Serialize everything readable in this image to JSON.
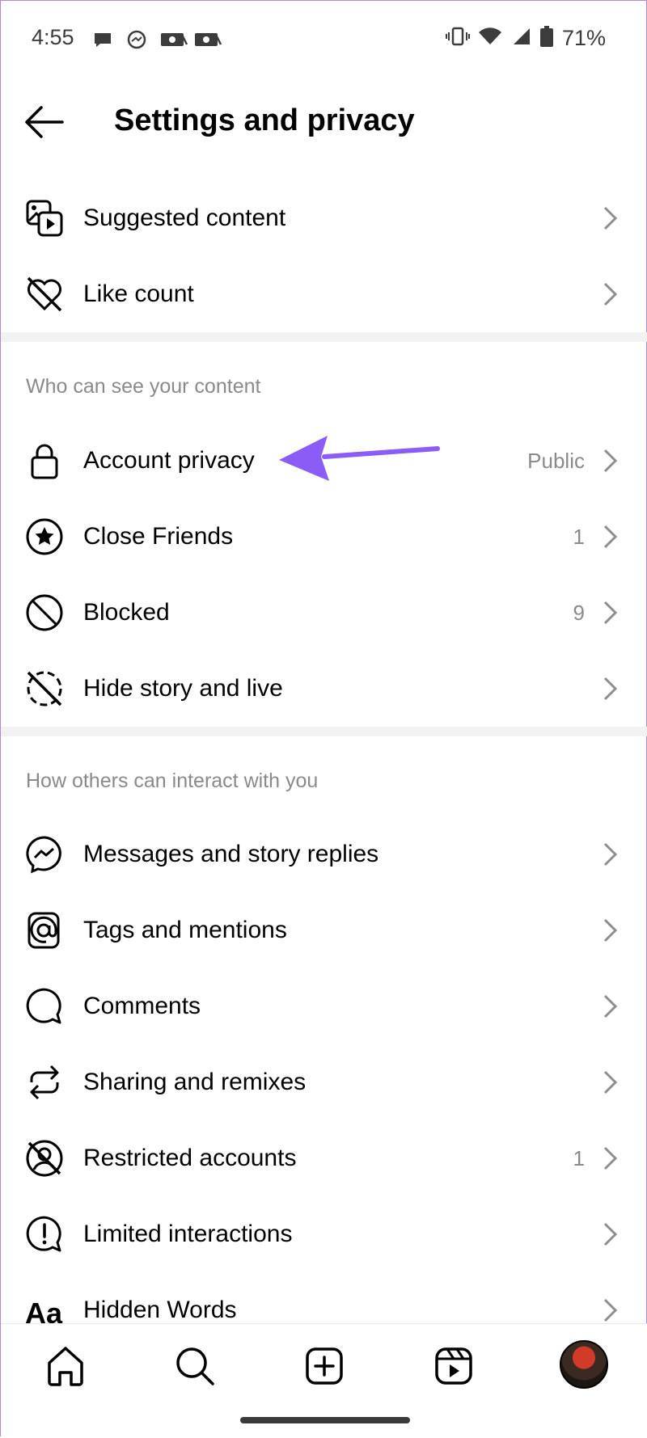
{
  "status_bar": {
    "time": "4:55",
    "battery": "71%"
  },
  "header": {
    "title": "Settings and privacy"
  },
  "rows_top": [
    {
      "label": "Suggested content",
      "icon": "suggested-content-icon"
    },
    {
      "label": "Like count",
      "icon": "heart-off-icon"
    }
  ],
  "section_visibility": {
    "header": "Who can see your content",
    "items": [
      {
        "label": "Account privacy",
        "value": "Public",
        "icon": "lock-icon"
      },
      {
        "label": "Close Friends",
        "value": "1",
        "icon": "star-circle-icon"
      },
      {
        "label": "Blocked",
        "value": "9",
        "icon": "blocked-icon"
      },
      {
        "label": "Hide story and live",
        "value": "",
        "icon": "story-off-icon"
      }
    ]
  },
  "section_interactions": {
    "header": "How others can interact with you",
    "items": [
      {
        "label": "Messages and story replies",
        "value": "",
        "icon": "messenger-icon"
      },
      {
        "label": "Tags and mentions",
        "value": "",
        "icon": "at-sign-icon"
      },
      {
        "label": "Comments",
        "value": "",
        "icon": "comment-icon"
      },
      {
        "label": "Sharing and remixes",
        "value": "",
        "icon": "share-remix-icon"
      },
      {
        "label": "Restricted accounts",
        "value": "1",
        "icon": "restricted-icon"
      },
      {
        "label": "Limited interactions",
        "value": "",
        "icon": "limited-interactions-icon"
      },
      {
        "label": "Hidden Words",
        "value": "",
        "icon": "text-aa-icon"
      }
    ]
  },
  "colors": {
    "annotation_arrow": "#8b5cf6",
    "secondary_text": "#8a8a8a",
    "divider": "#f2f2f2"
  }
}
